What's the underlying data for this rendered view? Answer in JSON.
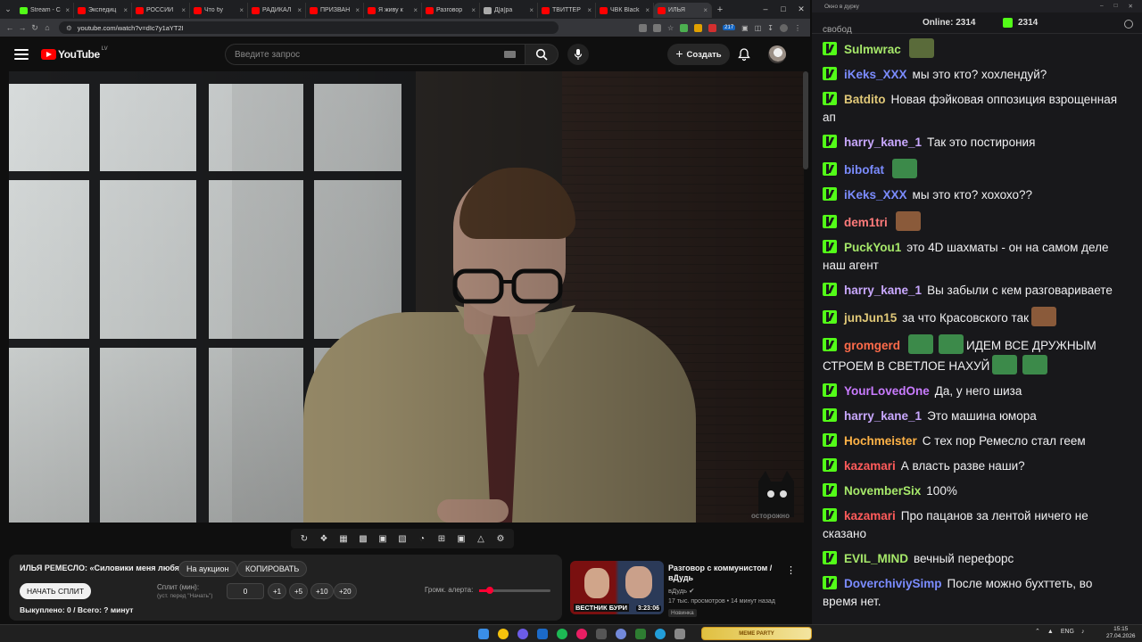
{
  "browser": {
    "tabs": [
      {
        "label": "Stream - С",
        "color": "#53fc18",
        "active": false
      },
      {
        "label": "Экспедиц",
        "color": "#ff0000",
        "active": false
      },
      {
        "label": "РОССИЙ",
        "color": "#ff0000",
        "active": false
      },
      {
        "label": "Что бу",
        "color": "#ff0000",
        "active": false
      },
      {
        "label": "РАДИКАЛ",
        "color": "#ff0000",
        "active": false
      },
      {
        "label": "ПРИЗВАН",
        "color": "#ff0000",
        "active": false
      },
      {
        "label": "Я живу к",
        "color": "#ff0000",
        "active": false
      },
      {
        "label": "Разговор",
        "color": "#ff0000",
        "active": false
      },
      {
        "label": "Д[а]ра",
        "color": "#aaaaaa",
        "active": false
      },
      {
        "label": "ТВИТТЕР",
        "color": "#ff0000",
        "active": false
      },
      {
        "label": "ЧВК Black",
        "color": "#ff0000",
        "active": false
      },
      {
        "label": "ИЛЬЯ",
        "color": "#ff0000",
        "active": true
      }
    ],
    "url": "youtube.com/watch?v=dIc7y1aYT2I",
    "ext_badge": "217"
  },
  "youtube": {
    "logo_text": "YouTube",
    "region": "LV",
    "search_placeholder": "Введите запрос",
    "create_label": "Создать"
  },
  "video": {
    "watermark": "осторожно"
  },
  "extension": {
    "title": "ИЛЬЯ РЕМЕСЛО: «Силовики меня любят»",
    "auction_label": "На аукцион",
    "copy_label": "КОПИРОВАТЬ",
    "start_split_label": "НАЧАТЬ СПЛИТ",
    "split_label": "Сплит (мин):",
    "split_hint": "(уст. перед \"Начать\")",
    "split_value": "0",
    "add_buttons": [
      "+1",
      "+5",
      "+10",
      "+20"
    ],
    "volume_label": "Громк. алерта:",
    "volume_level": 0.15,
    "stats": "Выкуплено: 0 / Всего: ? минут"
  },
  "recommendation": {
    "title": "Разговор с коммунистом / вДудь",
    "channel": "вДудь",
    "meta": "17 тыс. просмотров • 14 минут назад",
    "badge": "Новинка",
    "thumb_caption": "ВЕСТНИК БУРИ",
    "duration": "3:23:06"
  },
  "chat": {
    "window_title": "Окно в дурку",
    "online_label": "Online: 2314",
    "kick_count": "2314",
    "partial_top": "свобод",
    "messages": [
      {
        "user": "Sulmwrac",
        "color": "#a6e86a",
        "text": "",
        "emotes_after": 1,
        "emote_color": "#5a6b3a"
      },
      {
        "user": "iKeks_XXX",
        "color": "#7b8cff",
        "text": "мы это кто? хохлендуй?"
      },
      {
        "user": "Batdito",
        "color": "#e0c878",
        "text": "Новая фэйковая оппозиция взрощенная ап"
      },
      {
        "user": "harry_kane_1",
        "color": "#c9a8ff",
        "text": "Так это постирония"
      },
      {
        "user": "bibofat",
        "color": "#7b8cff",
        "text": "",
        "emotes_after": 1,
        "emote_color": "#3c8a4a"
      },
      {
        "user": "iKeks_XXX",
        "color": "#7b8cff",
        "text": "мы это кто? хохохо??"
      },
      {
        "user": "dem1tri",
        "color": "#ff7b7b",
        "text": "",
        "emotes_after": 1,
        "emote_color": "#8a5a3a"
      },
      {
        "user": "PuckYou1",
        "color": "#a6e86a",
        "text": "это 4D шахматы - он на самом деле наш агент"
      },
      {
        "user": "harry_kane_1",
        "color": "#c9a8ff",
        "text": "Вы забыли с кем разговариваете"
      },
      {
        "user": "junJun15",
        "color": "#e0c878",
        "text": "за что Красовского так",
        "emotes_after": 1,
        "emote_color": "#8a5a3a"
      },
      {
        "user": "gromgerd",
        "color": "#ff6b4a",
        "text": "ИДЕМ ВСЕ ДРУЖНЫМ СТРОЕМ В СВЕТЛОЕ НАХУЙ",
        "emotes_before": 2,
        "emotes_after": 2,
        "emote_color": "#3c8a4a"
      },
      {
        "user": "YourLovedOne",
        "color": "#c97bff",
        "text": "Да, у него шиза"
      },
      {
        "user": "harry_kane_1",
        "color": "#c9a8ff",
        "text": "Это машина юмора"
      },
      {
        "user": "Hochmeister",
        "color": "#ffb347",
        "text": "С тех пор Ремесло стал геем"
      },
      {
        "user": "kazamari",
        "color": "#ff5b5b",
        "text": "А власть разве наши?"
      },
      {
        "user": "NovemberSix",
        "color": "#a6e86a",
        "text": "100%"
      },
      {
        "user": "kazamari",
        "color": "#ff5b5b",
        "text": "Про пацанов за лентой ничего не сказано"
      },
      {
        "user": "EVIL_MIND",
        "color": "#a6e86a",
        "text": "вечный перефорс"
      },
      {
        "user": "DoverchiviySimp",
        "color": "#7b8cff",
        "text": "После можно бухттеть, во время нет."
      }
    ]
  },
  "taskbar": {
    "meme_party": "MEME PARTY",
    "lang": "ENG",
    "time": "15:15",
    "date": "27.04.2026"
  }
}
